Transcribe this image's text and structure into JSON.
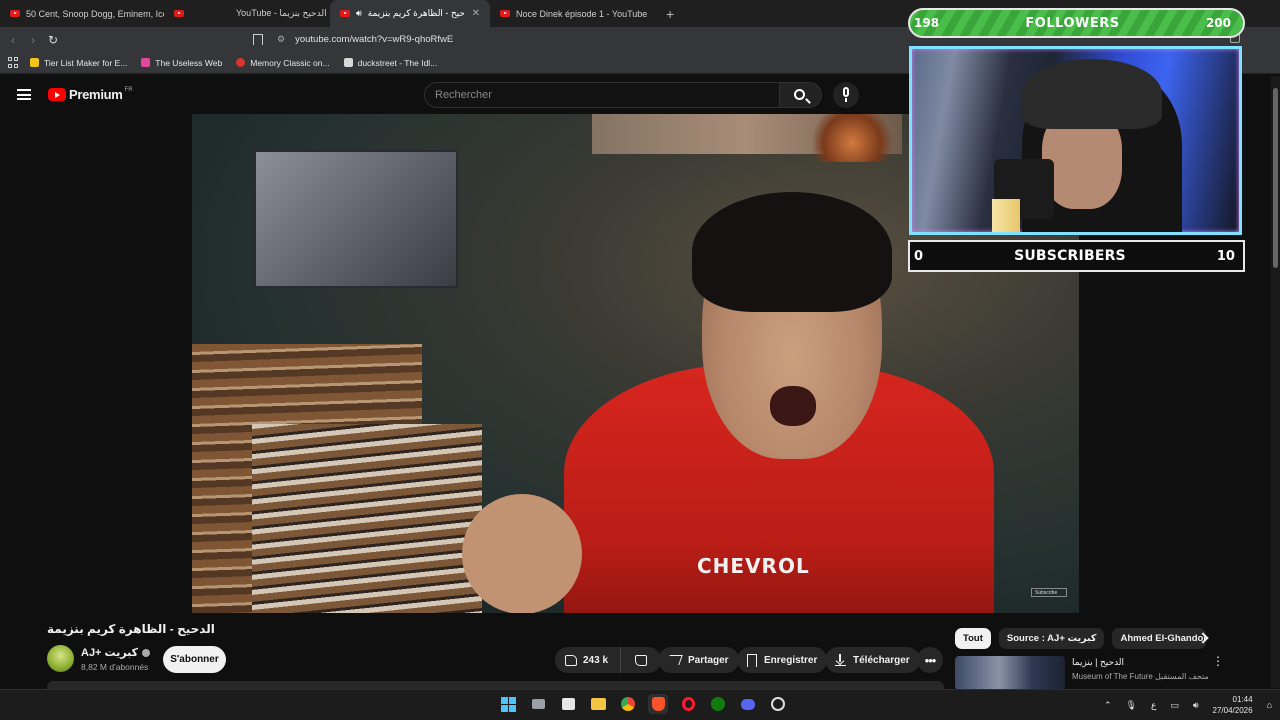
{
  "browser": {
    "tabs": [
      {
        "label": "50 Cent, Snoop Dogg, Eminem, Ice C",
        "active": false
      },
      {
        "label": "YouTube - الدحيح بنزيما",
        "active": false
      },
      {
        "label": "الدحيح - الظاهرة كريم بنزيمة -",
        "active": true
      },
      {
        "label": "Noce Dinek épisode 1 - YouTube",
        "active": false
      }
    ],
    "new_tab": "+",
    "tab_close": "✕",
    "url": "youtube.com/watch?v=wR9-qhoRfwE",
    "bookmarks": [
      {
        "label": "Tier List Maker for E...",
        "color": "#f5c518"
      },
      {
        "label": "The Useless Web",
        "color": "#e0489a"
      },
      {
        "label": "Memory Classic on...",
        "color": "#d9352a"
      },
      {
        "label": "duckstreet - The Idl...",
        "color": "#d8d8d8"
      }
    ]
  },
  "youtube": {
    "logo_text": "Premium",
    "region": "FR",
    "search_placeholder": "Rechercher"
  },
  "overlay": {
    "followers": {
      "current": "198",
      "label": "FOLLOWERS",
      "goal": "200"
    },
    "subscribers": {
      "current": "0",
      "label": "SUBSCRIBERS",
      "goal": "10"
    }
  },
  "video": {
    "sponsor_text": "CHEVROL",
    "watermark": "Subscribe",
    "title": "الدحيح - الظاهرة كريم بنزيمة",
    "channel": "AJ+ كبريت",
    "subscribers": "8,82 M d'abonnés",
    "subscribe_label": "S'abonner",
    "likes": "243 k",
    "share_label": "Partager",
    "save_label": "Enregistrer",
    "download_label": "Télécharger",
    "more_label": "•••"
  },
  "sidebar": {
    "chips": [
      {
        "label": "Tout",
        "active": true
      },
      {
        "label": "Source : AJ+ كبريت",
        "active": false
      },
      {
        "label": "Ahmed El-Ghandour",
        "active": false
      }
    ],
    "recommendation": {
      "title": "الدحيح | بنزيما",
      "channel": "Museum of The Future متحف المستقبل"
    }
  },
  "taskbar": {
    "input_indicator": "ع",
    "time": "01:44",
    "date": "27/04/2026"
  }
}
